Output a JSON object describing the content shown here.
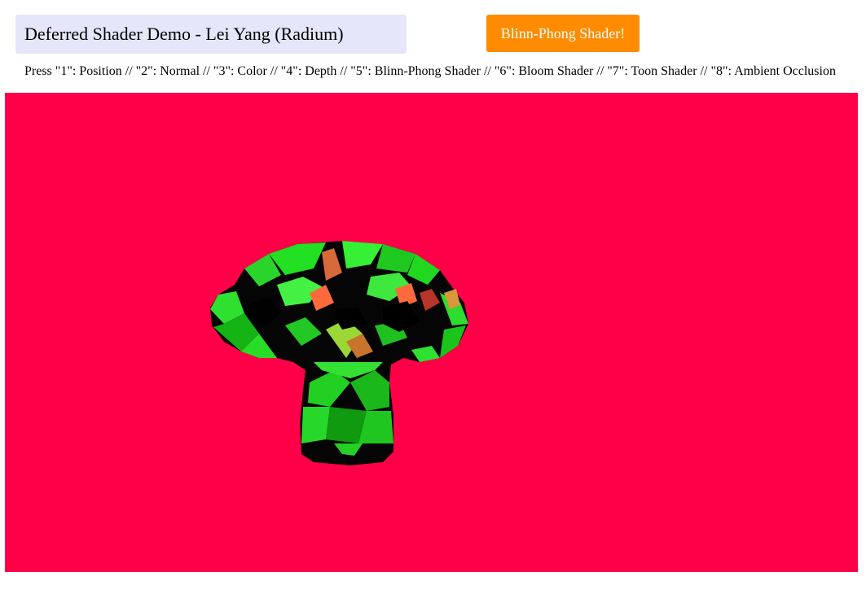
{
  "header": {
    "title": "Deferred Shader Demo - Lei Yang (Radium)",
    "shader_button_label": "Blinn-Phong Shader!"
  },
  "instructions": {
    "text": "Press \"1\": Position // \"2\": Normal // \"3\": Color // \"4\": Depth // \"5\": Blinn-Phong Shader // \"6\": Bloom Shader // \"7\": Toon Shader // \"8\": Ambient Occlusion"
  },
  "viewport": {
    "background_color": "#ff0048",
    "model": "suzanne-monkey-head",
    "model_colors": [
      "#22ee22",
      "#0a0a0a",
      "#ff6a3d"
    ]
  }
}
